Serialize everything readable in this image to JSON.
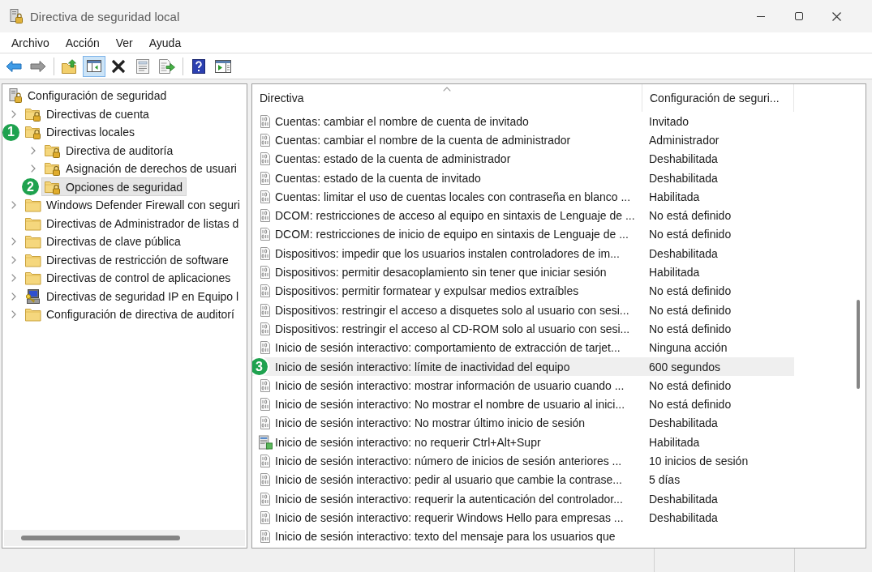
{
  "window": {
    "title": "Directiva de seguridad local"
  },
  "menu": [
    "Archivo",
    "Acción",
    "Ver",
    "Ayuda"
  ],
  "toolbar": [
    [
      {
        "kind": "back",
        "disabled": false,
        "pressed": false
      },
      {
        "kind": "forward",
        "disabled": true,
        "pressed": false
      }
    ],
    [
      {
        "kind": "up",
        "disabled": false,
        "pressed": false
      },
      {
        "kind": "tree",
        "disabled": false,
        "pressed": true
      },
      {
        "kind": "delete",
        "disabled": false,
        "pressed": false
      },
      {
        "kind": "properties",
        "disabled": false,
        "pressed": false
      },
      {
        "kind": "export",
        "disabled": false,
        "pressed": false
      }
    ],
    [
      {
        "kind": "help",
        "disabled": false,
        "pressed": false
      },
      {
        "kind": "actions",
        "disabled": false,
        "pressed": false
      }
    ]
  ],
  "tree": {
    "label": "Configuración de seguridad",
    "selected": false,
    "children": [
      {
        "label": "Directivas de cuenta",
        "kind": "secured",
        "expandable": true,
        "expanded": false,
        "selected": false
      },
      {
        "label": "Directivas locales",
        "kind": "secured",
        "expanded": true,
        "selected": false,
        "step_marker": "1",
        "children": [
          {
            "label": "Directiva de auditoría",
            "kind": "secured",
            "expandable": true,
            "expanded": false,
            "selected": false
          },
          {
            "label": "Asignación de derechos de usuari",
            "kind": "secured",
            "expandable": true,
            "expanded": false,
            "selected": false
          },
          {
            "label": "Opciones de seguridad",
            "kind": "secured",
            "selected": true,
            "step_marker": "2"
          }
        ]
      },
      {
        "label": "Windows Defender Firewall con seguri",
        "kind": "plain",
        "expandable": true,
        "expanded": false,
        "selected": false
      },
      {
        "label": "Directivas de Administrador de listas d",
        "kind": "plain",
        "expandable": false,
        "expanded": false,
        "selected": false
      },
      {
        "label": "Directivas de clave pública",
        "kind": "plain",
        "expandable": true,
        "expanded": false,
        "selected": false
      },
      {
        "label": "Directivas de restricción de software",
        "kind": "plain",
        "expandable": true,
        "expanded": false,
        "selected": false
      },
      {
        "label": "Directivas de control de aplicaciones",
        "kind": "plain",
        "expandable": true,
        "expanded": false,
        "selected": false
      },
      {
        "label": "Directivas de seguridad IP en Equipo l",
        "kind": "ipsec",
        "expandable": true,
        "expanded": false,
        "selected": false
      },
      {
        "label": "Configuración de directiva de auditorí",
        "kind": "plain",
        "expandable": true,
        "expanded": false,
        "selected": false
      }
    ]
  },
  "list": {
    "columns": [
      {
        "label": "Directiva",
        "sorted": true
      },
      {
        "label": "Configuración de seguri...",
        "sorted": false
      }
    ],
    "rows": [
      {
        "policy": "Cuentas: cambiar el nombre de cuenta de invitado",
        "security_setting": "Invitado",
        "kind": "standard",
        "selected": false
      },
      {
        "policy": "Cuentas: cambiar el nombre de la cuenta de administrador",
        "security_setting": "Administrador",
        "kind": "standard",
        "selected": false
      },
      {
        "policy": "Cuentas: estado de la cuenta de administrador",
        "security_setting": "Deshabilitada",
        "kind": "standard",
        "selected": false
      },
      {
        "policy": "Cuentas: estado de la cuenta de invitado",
        "security_setting": "Deshabilitada",
        "kind": "standard",
        "selected": false
      },
      {
        "policy": "Cuentas: limitar el uso de cuentas locales con contraseña en blanco ...",
        "security_setting": "Habilitada",
        "kind": "standard",
        "selected": false
      },
      {
        "policy": "DCOM: restricciones de acceso al equipo en sintaxis de Lenguaje de ...",
        "security_setting": "No está definido",
        "kind": "standard",
        "selected": false
      },
      {
        "policy": "DCOM: restricciones de inicio de equipo en sintaxis de Lenguaje de ...",
        "security_setting": "No está definido",
        "kind": "standard",
        "selected": false
      },
      {
        "policy": "Dispositivos: impedir que los usuarios instalen controladores de im...",
        "security_setting": "Deshabilitada",
        "kind": "standard",
        "selected": false
      },
      {
        "policy": "Dispositivos: permitir desacoplamiento sin tener que iniciar sesión",
        "security_setting": "Habilitada",
        "kind": "standard",
        "selected": false
      },
      {
        "policy": "Dispositivos: permitir formatear y expulsar medios extraíbles",
        "security_setting": "No está definido",
        "kind": "standard",
        "selected": false
      },
      {
        "policy": "Dispositivos: restringir el acceso a disquetes solo al usuario con sesi...",
        "security_setting": "No está definido",
        "kind": "standard",
        "selected": false
      },
      {
        "policy": "Dispositivos: restringir el acceso al CD-ROM solo al usuario con sesi...",
        "security_setting": "No está definido",
        "kind": "standard",
        "selected": false
      },
      {
        "policy": "Inicio de sesión interactivo: comportamiento de extracción de tarjet...",
        "security_setting": "Ninguna acción",
        "kind": "standard",
        "selected": false
      },
      {
        "policy": "Inicio de sesión interactivo: límite de inactividad del equipo",
        "security_setting": "600 segundos",
        "selected": true,
        "step_marker": "3"
      },
      {
        "policy": "Inicio de sesión interactivo: mostrar información de usuario cuando ...",
        "security_setting": "No está definido",
        "kind": "standard",
        "selected": false
      },
      {
        "policy": "Inicio de sesión interactivo: No mostrar el nombre de usuario al inici...",
        "security_setting": "No está definido",
        "kind": "standard",
        "selected": false
      },
      {
        "policy": "Inicio de sesión interactivo: No mostrar último inicio de sesión",
        "security_setting": "Deshabilitada",
        "kind": "standard",
        "selected": false
      },
      {
        "policy": "Inicio de sesión interactivo: no requerir Ctrl+Alt+Supr",
        "security_setting": "Habilitada",
        "kind": "special",
        "selected": false
      },
      {
        "policy": "Inicio de sesión interactivo: número de inicios de sesión anteriores ...",
        "security_setting": "10 inicios de sesión",
        "kind": "standard",
        "selected": false
      },
      {
        "policy": "Inicio de sesión interactivo: pedir al usuario que cambie la contrase...",
        "security_setting": "5 días",
        "kind": "standard",
        "selected": false
      },
      {
        "policy": "Inicio de sesión interactivo: requerir la autenticación del controlador...",
        "security_setting": "Deshabilitada",
        "kind": "standard",
        "selected": false
      },
      {
        "policy": "Inicio de sesión interactivo: requerir Windows Hello para empresas ...",
        "security_setting": "Deshabilitada",
        "kind": "standard",
        "selected": false
      },
      {
        "policy": "Inicio de sesión interactivo: texto del mensaje para los usuarios que",
        "kind": "standard",
        "selected": false
      }
    ]
  }
}
